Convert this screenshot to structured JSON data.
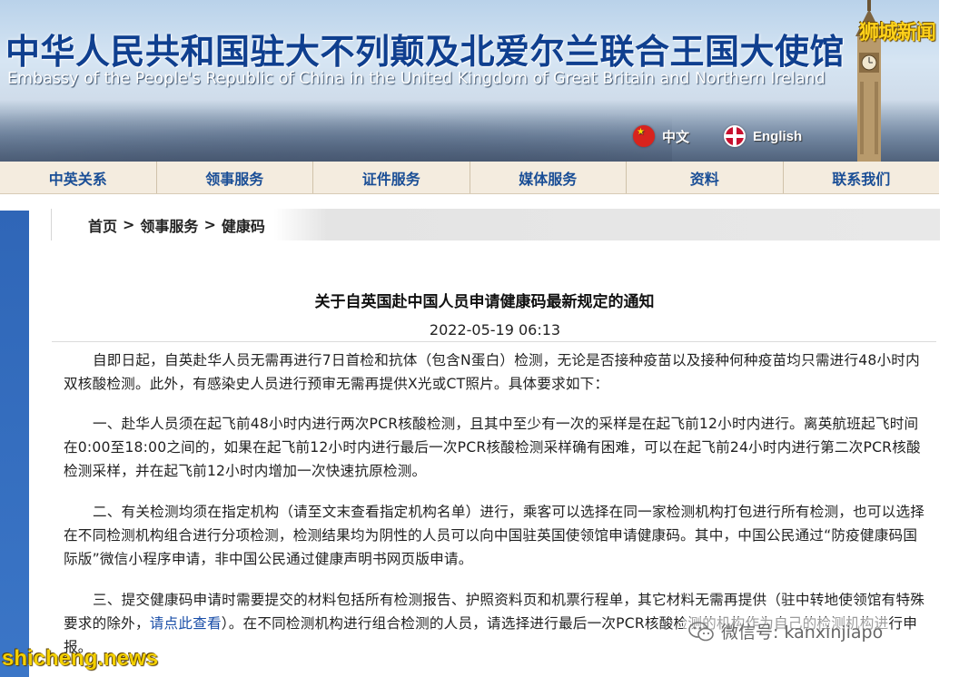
{
  "banner": {
    "title_cn": "中华人民共和国驻大不列颠及北爱尔兰联合王国大使馆",
    "title_en": "Embassy of the People's Republic of China in the United Kingdom of Great Britain and Northern Ireland",
    "lang_cn": "中文",
    "lang_en": "English"
  },
  "watermarks": {
    "top": "狮城新闻",
    "bottom": "shicheng.news",
    "wechat": "微信号: kanxinjiapo"
  },
  "nav": {
    "items": [
      "中英关系",
      "领事服务",
      "证件服务",
      "媒体服务",
      "资料",
      "联系我们"
    ]
  },
  "breadcrumb": {
    "items": [
      "首页",
      "领事服务",
      "健康码"
    ],
    "separator": ">"
  },
  "article": {
    "title": "关于自英国赴中国人员申请健康码最新规定的通知",
    "date": "2022-05-19 06:13",
    "p1": "自即日起，自英赴华人员无需再进行7日首检和抗体（包含N蛋白）检测，无论是否接种疫苗以及接种何种疫苗均只需进行48小时内双核酸检测。此外，有感染史人员进行预审无需再提供X光或CT照片。具体要求如下：",
    "p2": "一、赴华人员须在起飞前48小时内进行两次PCR核酸检测，且其中至少有一次的采样是在起飞前12小时内进行。离英航班起飞时间在0:00至18:00之间的，如果在起飞前12小时内进行最后一次PCR核酸检测采样确有困难，可以在起飞前24小时内进行第二次PCR核酸检测采样，并在起飞前12小时内增加一次快速抗原检测。",
    "p3": "二、有关检测均须在指定机构（请至文末查看指定机构名单）进行，乘客可以选择在同一家检测机构打包进行所有检测，也可以选择在不同检测机构组合进行分项检测，检测结果均为阴性的人员可以向中国驻英国使领馆申请健康码。其中，中国公民通过“防疫健康码国际版”微信小程序申请，非中国公民通过健康声明书网页版申请。",
    "p4_before": "三、提交健康码申请时需要提交的材料包括所有检测报告、护照资料页和机票行程单，其它材料无需再提供（驻中转地使领馆有特殊要求的除外，",
    "p4_link": "请点此查看",
    "p4_after": "）。在不同检测机构进行组合检测的人员，请选择进行最后一次PCR核酸检测的机构作为自己的检测机构进行申报。"
  },
  "colors": {
    "nav_bg": "#f4ecdf",
    "nav_text": "#1a4e96",
    "title_cn": "#0f3f8f",
    "link": "#1a4ea8",
    "left_strip": "#2f66b7"
  }
}
